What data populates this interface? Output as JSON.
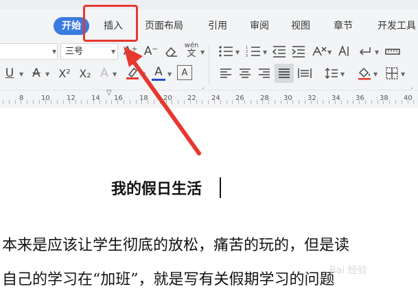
{
  "ribbon": {
    "tabs": [
      "开始",
      "插入",
      "页面布局",
      "引用",
      "审阅",
      "视图",
      "章节",
      "开发工具"
    ],
    "active_tab": "开始",
    "highlighted_tab": "插入"
  },
  "toolbar": {
    "font_size_value": "三号",
    "font_name_value": "",
    "pinyin_label": "wén",
    "buttons": {
      "grow_font": "A⁺",
      "shrink_font": "A⁻",
      "underline": "U",
      "strikethrough": "A",
      "superscript": "X²",
      "subscript": "X₂",
      "text_effect": "A",
      "font_color": "A",
      "char_border": "A"
    }
  },
  "ruler": {
    "numbers": [
      "8",
      "10",
      "12",
      "14",
      "16",
      "18",
      "20",
      "22",
      "24",
      "26",
      "28",
      "30",
      "32",
      "34",
      "36",
      "38",
      "40"
    ]
  },
  "document": {
    "title": "我的假日生活",
    "lines": [
      "本来是应该让学生彻底的放松，痛苦的玩的，但是读",
      "自己的学习在“加班”，就是写有关假期学习的问题"
    ]
  },
  "colors": {
    "active_tab_bg": "#3b7be0",
    "annotation": "#e8372f",
    "font_color_bar": "#1f4ec9",
    "highlight_bar": "#e8372f"
  },
  "watermark": {
    "text": "Bai 经验"
  }
}
